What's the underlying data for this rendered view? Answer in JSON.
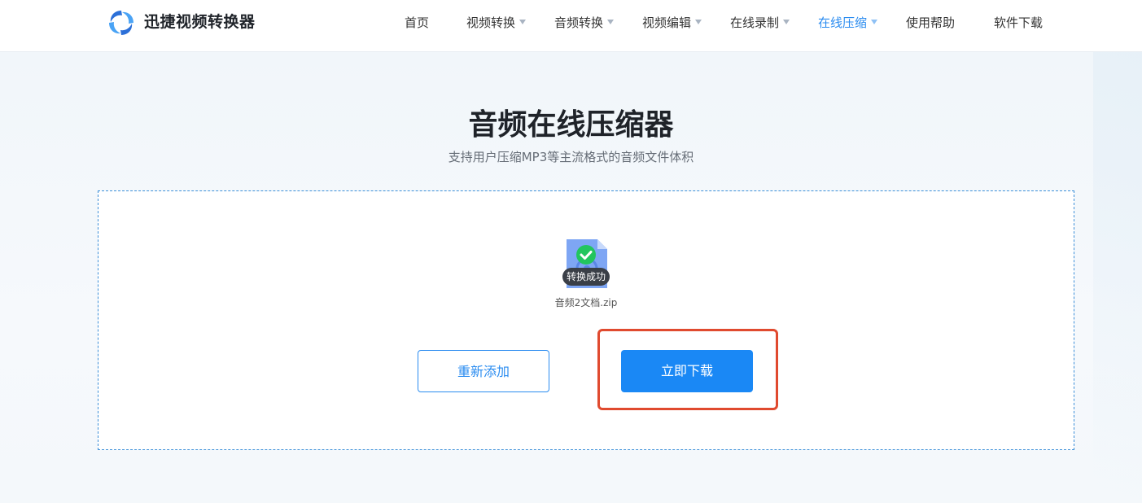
{
  "header": {
    "brand": "迅捷视频转换器",
    "logo_icon": "swirl-logo-icon",
    "nav": [
      {
        "label": "首页",
        "has_dropdown": false,
        "active": false
      },
      {
        "label": "视频转换",
        "has_dropdown": true,
        "active": false
      },
      {
        "label": "音频转换",
        "has_dropdown": true,
        "active": false
      },
      {
        "label": "视频编辑",
        "has_dropdown": true,
        "active": false
      },
      {
        "label": "在线录制",
        "has_dropdown": true,
        "active": false
      },
      {
        "label": "在线压缩",
        "has_dropdown": true,
        "active": true
      },
      {
        "label": "使用帮助",
        "has_dropdown": false,
        "active": false
      },
      {
        "label": "软件下载",
        "has_dropdown": false,
        "active": false
      }
    ]
  },
  "page": {
    "title": "音频在线压缩器",
    "subtitle": "支持用户压缩MP3等主流格式的音频文件体积"
  },
  "result": {
    "file_icon": "audio-file-icon",
    "check_icon": "check-circle-icon",
    "status_badge": "转换成功",
    "filename": "音频2文档.zip",
    "readd_button": "重新添加",
    "download_button": "立即下载"
  },
  "colors": {
    "accent": "#2b8cf0",
    "primary_button": "#1a88f5",
    "success": "#22c55e",
    "highlight": "#e04a2f"
  }
}
